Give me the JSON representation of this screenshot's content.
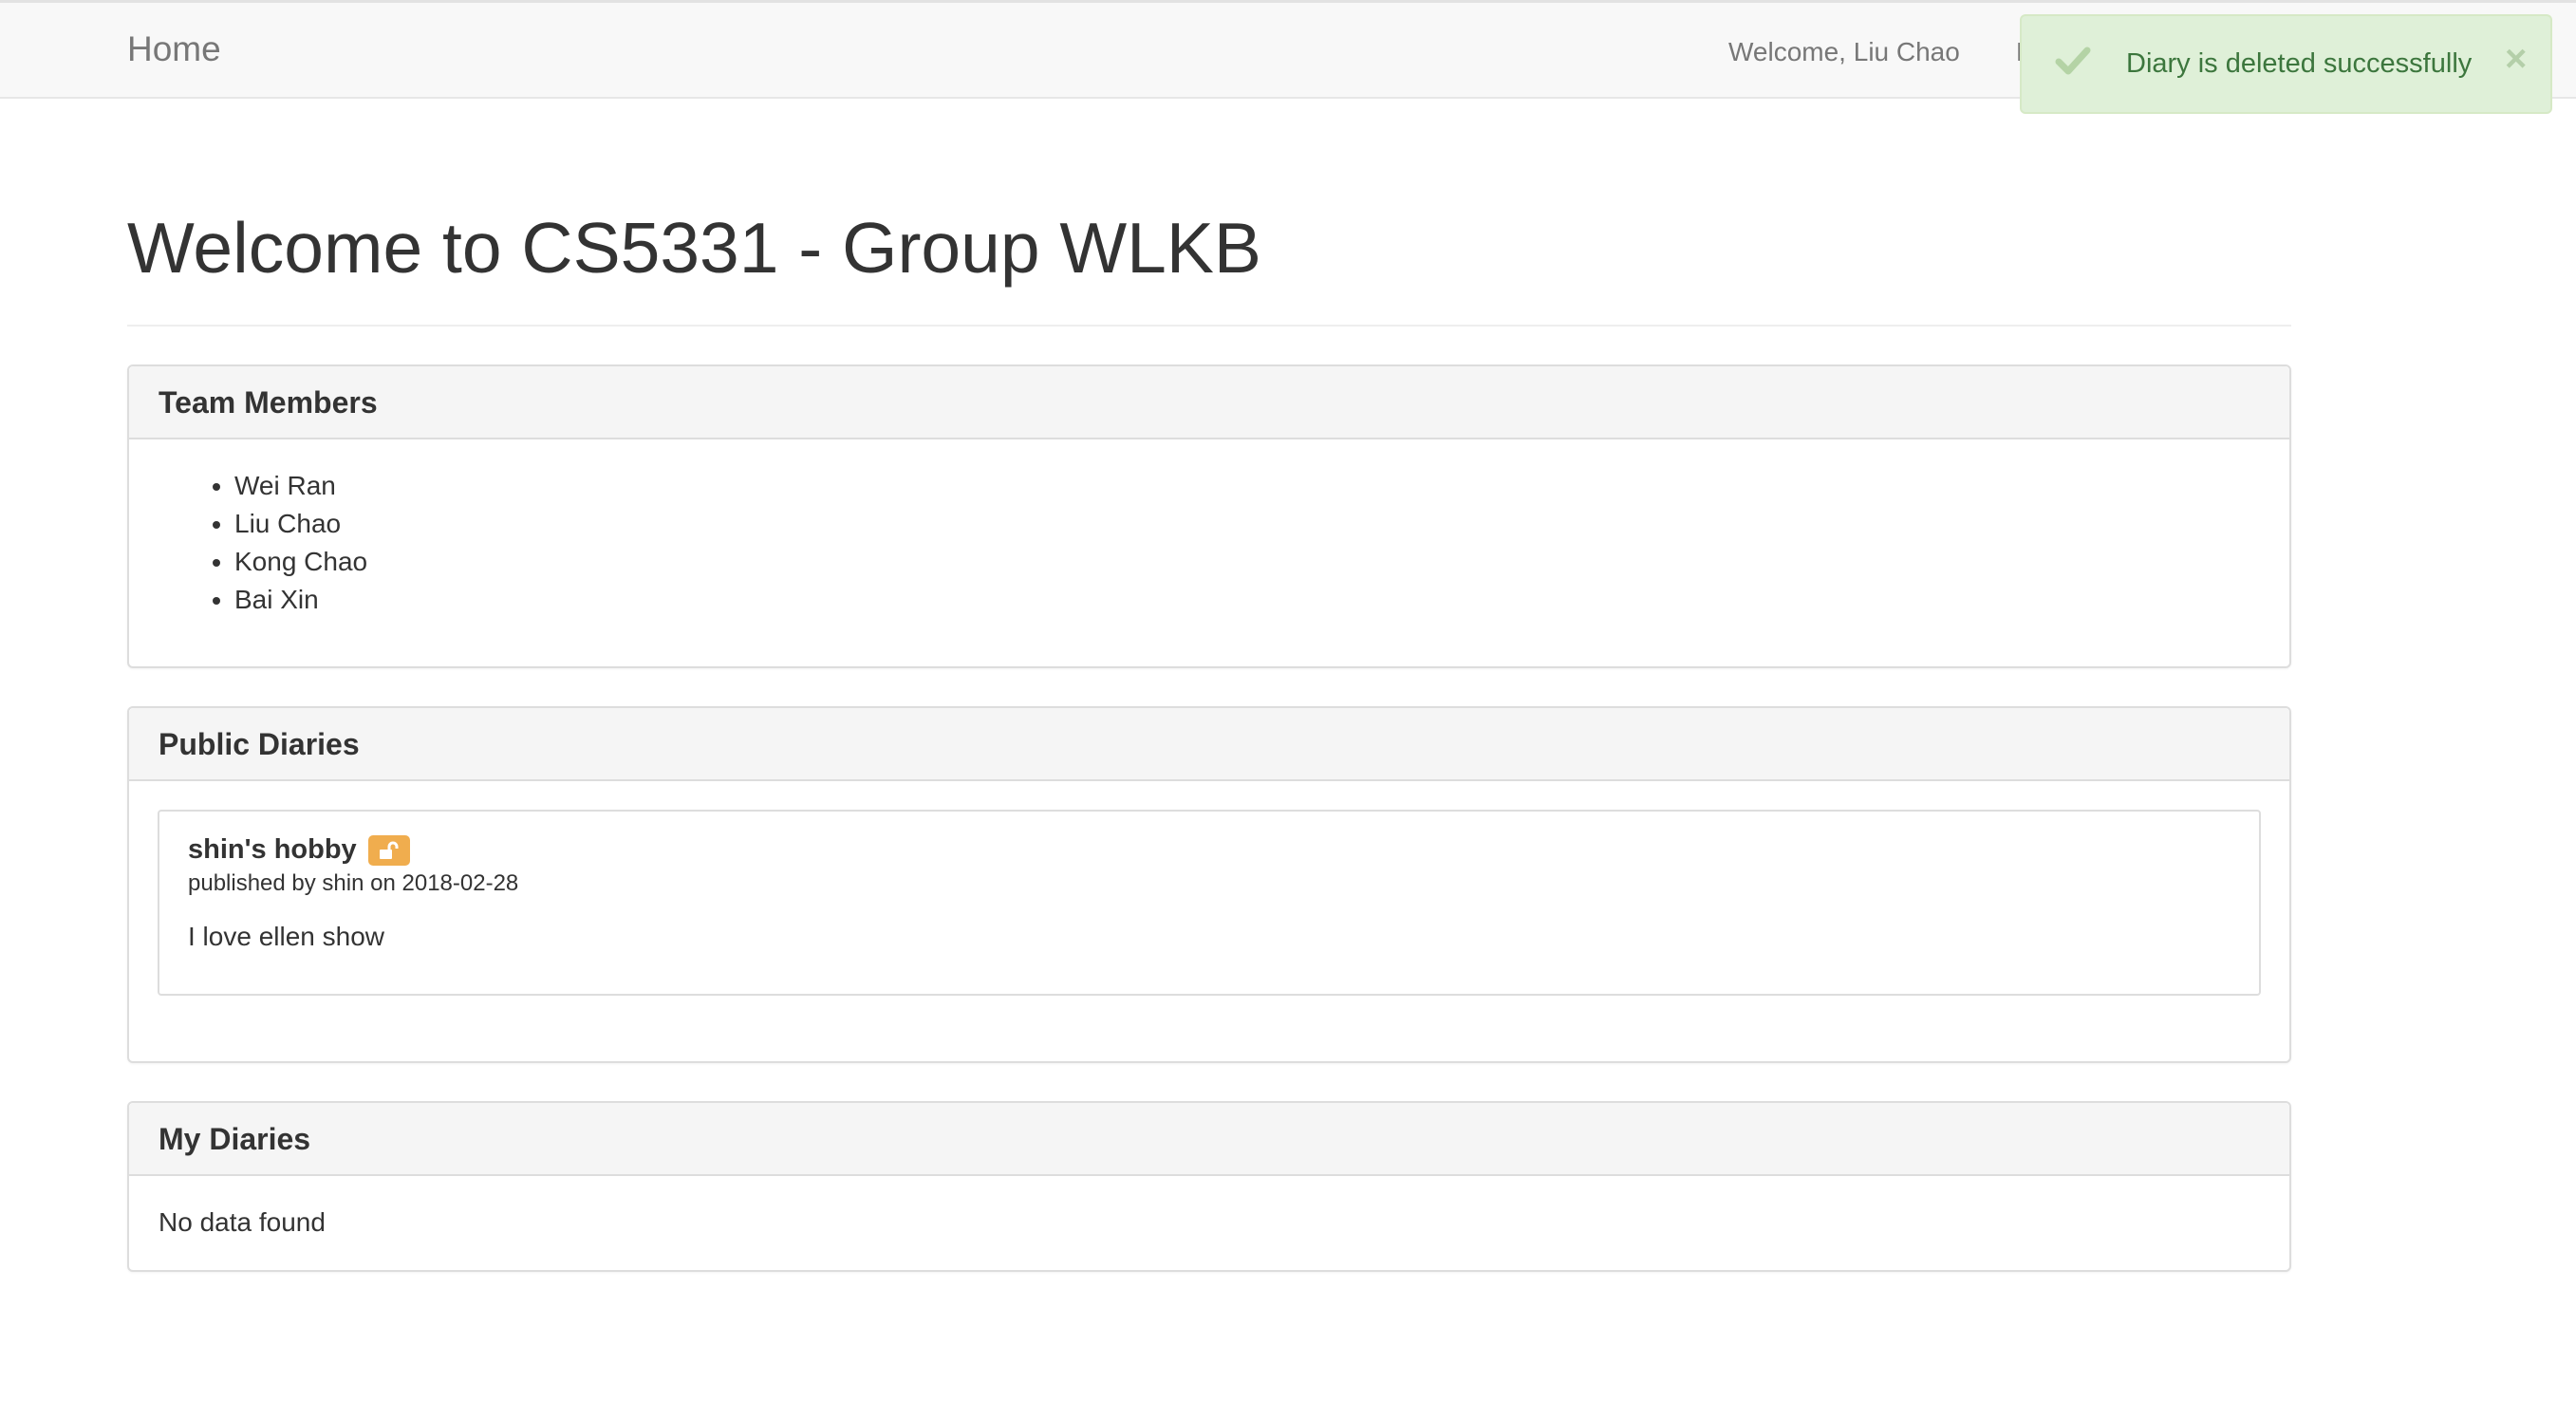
{
  "navbar": {
    "brand": "Home",
    "welcome": "Welcome, Liu Chao",
    "partial_link": "L"
  },
  "toast": {
    "icon": "check-icon",
    "message": "Diary is deleted successfully",
    "close": "×"
  },
  "page": {
    "title": "Welcome to CS5331 - Group WLKB"
  },
  "team_panel": {
    "heading": "Team Members",
    "members": [
      "Wei Ran",
      "Liu Chao",
      "Kong Chao",
      "Bai Xin"
    ]
  },
  "public_panel": {
    "heading": "Public Diaries",
    "diaries": [
      {
        "title": "shin's hobby",
        "badge_icon": "unlock-icon",
        "meta": "published by shin on 2018-02-28",
        "body": "I love ellen show"
      }
    ]
  },
  "my_panel": {
    "heading": "My Diaries",
    "empty_text": "No data found"
  },
  "colors": {
    "toast_bg": "#dff0d8",
    "toast_text": "#3c763d",
    "badge_warning": "#f0ad4e",
    "navbar_bg": "#f8f8f8"
  }
}
